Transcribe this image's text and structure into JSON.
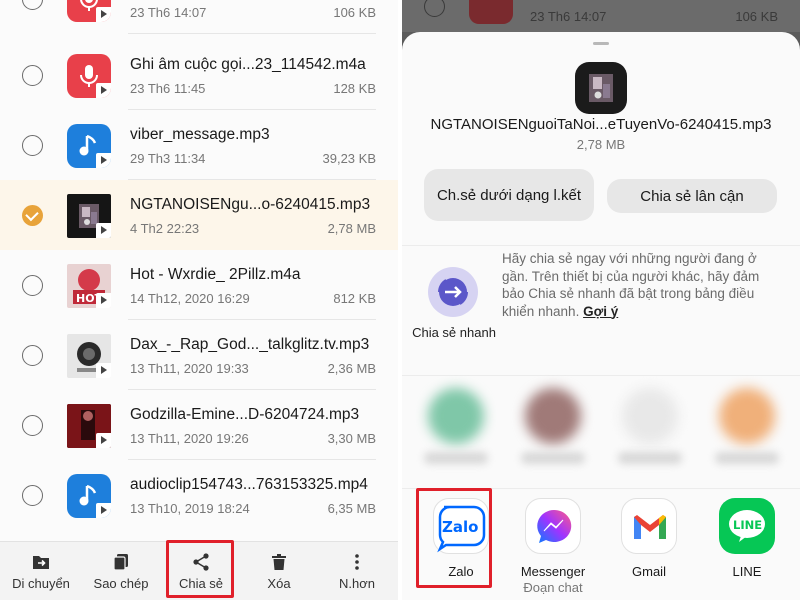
{
  "files": [
    {
      "name": "",
      "date": "23 Th6 14:07",
      "size": "106 KB",
      "kind": "voice",
      "selected": false
    },
    {
      "name": "Ghi âm cuộc gọi...23_114542.m4a",
      "date": "23 Th6 11:45",
      "size": "128 KB",
      "kind": "voice",
      "selected": false
    },
    {
      "name": "viber_message.mp3",
      "date": "29 Th3 11:34",
      "size": "39,23 KB",
      "kind": "music",
      "selected": false
    },
    {
      "name": "NGTANOISENgu...o-6240415.mp3",
      "date": "4 Th2 22:23",
      "size": "2,78 MB",
      "kind": "image",
      "selected": true
    },
    {
      "name": "Hot - Wxrdie_ 2Pillz.m4a",
      "date": "14 Th12, 2020 16:29",
      "size": "812 KB",
      "kind": "image",
      "selected": false
    },
    {
      "name": "Dax_-_Rap_God..._talkglitz.tv.mp3",
      "date": "13 Th11, 2020 19:33",
      "size": "2,36 MB",
      "kind": "image",
      "selected": false
    },
    {
      "name": "Godzilla-Emine...D-6204724.mp3",
      "date": "13 Th11, 2020 19:26",
      "size": "3,30 MB",
      "kind": "image",
      "selected": false
    },
    {
      "name": "audioclip154743...763153325.mp4",
      "date": "13 Th10, 2019 18:24",
      "size": "6,35 MB",
      "kind": "music",
      "selected": false
    }
  ],
  "toolbar": {
    "move": "Di chuyển",
    "copy": "Sao chép",
    "share": "Chia sẻ",
    "delete": "Xóa",
    "more": "N.hơn"
  },
  "background_row": {
    "date": "23 Th6 14:07",
    "size": "106 KB"
  },
  "share_sheet": {
    "file_name": "NGTANOISENguoiTaNoi...eTuyenVo-6240415.mp3",
    "file_size": "2,78 MB",
    "share_link_button": "Ch.sẻ dưới dạng l.kết",
    "nearby_share_button": "Chia sẻ lân cận",
    "quick_share_label": "Chia sẻ nhanh",
    "quick_share_desc": "Hãy chia sẻ ngay với những người đang ở gần. Trên thiết bị của người khác, hãy đảm bảo Chia sẻ nhanh đã bật trong bảng điều khiển nhanh.",
    "quick_share_link": "Gợi ý",
    "apps": [
      {
        "name": "Zalo",
        "sub": "",
        "icon": "zalo-icon"
      },
      {
        "name": "Messenger",
        "sub": "Đoạn chat",
        "icon": "messenger-icon"
      },
      {
        "name": "Gmail",
        "sub": "",
        "icon": "gmail-icon"
      },
      {
        "name": "LINE",
        "sub": "",
        "icon": "line-icon"
      }
    ]
  },
  "colors": {
    "accent": "#e8a33a",
    "highlight_box": "#e0202a",
    "voice": "#e8404a",
    "music": "#1e7fdc"
  }
}
